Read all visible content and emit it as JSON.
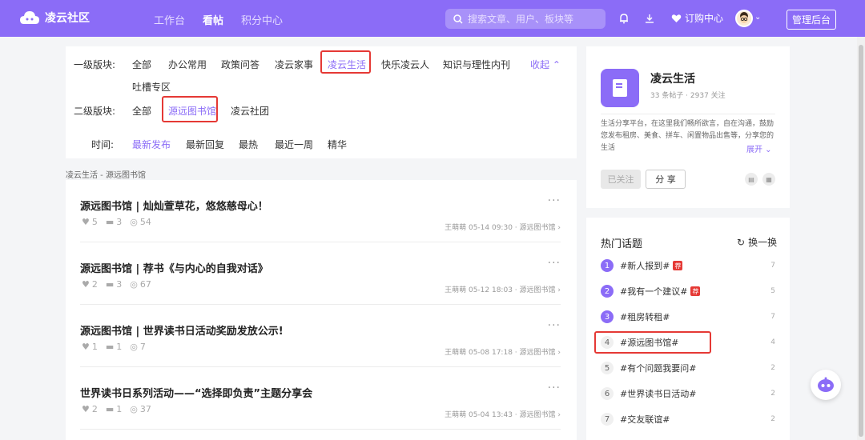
{
  "header": {
    "brand": "凌云社区",
    "nav": [
      "工作台",
      "看帖",
      "积分中心"
    ],
    "active_nav": "看帖",
    "search_placeholder": "搜索文章、用户、板块等",
    "subscribe_label": "订购中心",
    "admin_label": "管理后台"
  },
  "filters": {
    "level1_label": "一级版块:",
    "level1_items": [
      "全部",
      "办公常用",
      "政策问答",
      "凌云家事",
      "凌云生活",
      "快乐凌云人",
      "知识与理性内刊",
      "吐槽专区"
    ],
    "level1_active": "凌云生活",
    "collapse_label": "收起",
    "level2_label": "二级版块:",
    "level2_items": [
      "全部",
      "源远图书馆",
      "凌云社团"
    ],
    "level2_active": "源远图书馆",
    "time_label": "时间:",
    "time_items": [
      "最新发布",
      "最新回复",
      "最热",
      "最近一周",
      "精华"
    ],
    "time_active": "最新发布"
  },
  "breadcrumb": "凌云生活 - 源远图书馆",
  "posts": [
    {
      "title": "源远图书馆 | 灿灿萱草花，悠悠慈母心！",
      "likes": "5",
      "comments": "3",
      "views": "54",
      "author": "王萌萌",
      "date": "05-14 09:30",
      "board": "· 源远图书馆"
    },
    {
      "title": "源远图书馆 | 荐书《与内心的自我对话》",
      "likes": "2",
      "comments": "3",
      "views": "67",
      "author": "王萌萌",
      "date": "05-12 18:03",
      "board": "· 源远图书馆"
    },
    {
      "title": "源远图书馆 | 世界读书日活动奖励发放公示!",
      "likes": "1",
      "comments": "1",
      "views": "7",
      "author": "王萌萌",
      "date": "05-08 17:18",
      "board": "· 源远图书馆"
    },
    {
      "title": "世界读书日系列活动——“选择即负责”主题分享会",
      "likes": "2",
      "comments": "1",
      "views": "37",
      "author": "王萌萌",
      "date": "05-04 13:43",
      "board": "· 源远图书馆"
    }
  ],
  "board": {
    "name": "凌云生活",
    "stats": "33 条帖子 · 2937 关注",
    "description": "生活分享平台，在这里我们畅所欲言，自在沟通，鼓励您发布租房、美食、拼车、闲置物品出售等，分享您的生活",
    "expand_label": "展开",
    "followed_label": "已关注",
    "share_label": "分 享"
  },
  "topics": {
    "title": "热门话题",
    "refresh_label": "换一换",
    "hot_badge": "荐",
    "items": [
      {
        "rank": "1",
        "name": "#新人报到#",
        "count": "7",
        "hot": true
      },
      {
        "rank": "2",
        "name": "#我有一个建议#",
        "count": "5",
        "hot": true
      },
      {
        "rank": "3",
        "name": "#租房转租#",
        "count": "7",
        "hot": false
      },
      {
        "rank": "4",
        "name": "#源远图书馆#",
        "count": "4",
        "hot": false
      },
      {
        "rank": "5",
        "name": "#有个问题我要问#",
        "count": "2",
        "hot": false
      },
      {
        "rank": "6",
        "name": "#世界读书日活动#",
        "count": "2",
        "hot": false
      },
      {
        "rank": "7",
        "name": "#交友联谊#",
        "count": "2",
        "hot": false
      }
    ]
  },
  "colors": {
    "accent": "#8b6cf7",
    "highlight": "#e53935"
  }
}
